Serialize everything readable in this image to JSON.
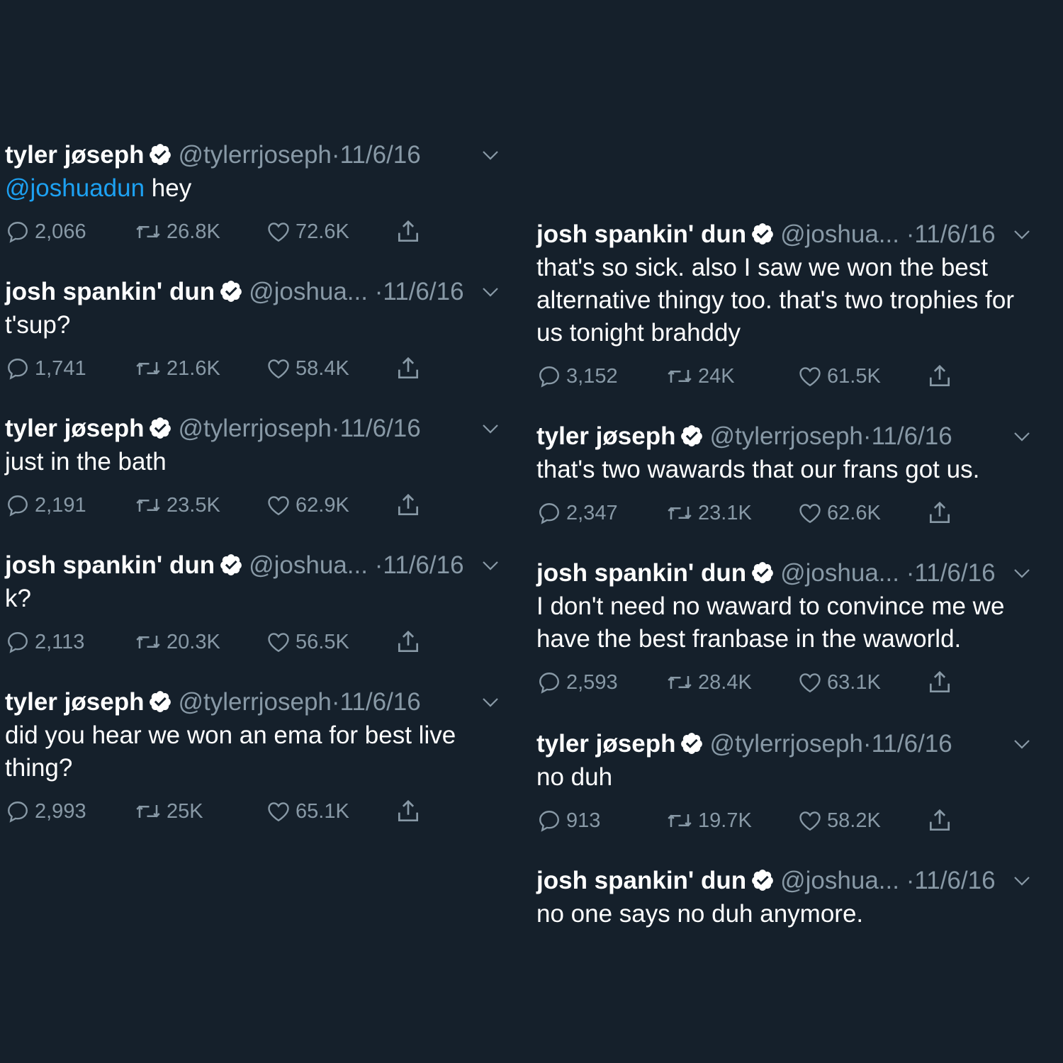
{
  "colors": {
    "background": "#15202b",
    "text": "#ffffff",
    "secondary": "#8899a6",
    "link": "#1da1f2"
  },
  "icons": [
    "verified-badge-icon",
    "chevron-down-icon",
    "reply-icon",
    "retweet-icon",
    "like-icon",
    "share-icon"
  ],
  "left_column": [
    {
      "name": "tyler jøseph",
      "handle": "@tylerrjoseph",
      "separator": "·",
      "date": "11/6/16",
      "mention": "@joshuadun",
      "text": " hey",
      "replies": "2,066",
      "retweets": "26.8K",
      "likes": "72.6K"
    },
    {
      "name": "josh spankin' dun",
      "handle": "@joshua...",
      "separator": " ·",
      "date": "11/6/16",
      "text": "t'sup?",
      "replies": "1,741",
      "retweets": "21.6K",
      "likes": "58.4K"
    },
    {
      "name": "tyler jøseph",
      "handle": "@tylerrjoseph",
      "separator": "·",
      "date": "11/6/16",
      "text": "just in the bath",
      "replies": "2,191",
      "retweets": "23.5K",
      "likes": "62.9K"
    },
    {
      "name": "josh spankin' dun",
      "handle": "@joshua...",
      "separator": " ·",
      "date": "11/6/16",
      "text": "k?",
      "replies": "2,113",
      "retweets": "20.3K",
      "likes": "56.5K"
    },
    {
      "name": "tyler jøseph",
      "handle": "@tylerrjoseph",
      "separator": "·",
      "date": "11/6/16",
      "text": "did you hear we won an ema for best live thing?",
      "replies": "2,993",
      "retweets": "25K",
      "likes": "65.1K"
    }
  ],
  "right_column": [
    {
      "name": "josh spankin' dun",
      "handle": "@joshua...",
      "separator": " ·",
      "date": "11/6/16",
      "text": "that's so sick. also I saw we won the best alternative thingy too. that's two trophies for us tonight brahddy",
      "replies": "3,152",
      "retweets": "24K",
      "likes": "61.5K"
    },
    {
      "name": "tyler jøseph",
      "handle": "@tylerrjoseph",
      "separator": "·",
      "date": "11/6/16",
      "text": "that's two wawards that our frans got us.",
      "replies": "2,347",
      "retweets": "23.1K",
      "likes": "62.6K"
    },
    {
      "name": "josh spankin' dun",
      "handle": "@joshua...",
      "separator": " ·",
      "date": "11/6/16",
      "text": "I don't need no waward to convince me we have the best franbase in the waworld.",
      "replies": "2,593",
      "retweets": "28.4K",
      "likes": "63.1K"
    },
    {
      "name": "tyler jøseph",
      "handle": "@tylerrjoseph",
      "separator": "·",
      "date": "11/6/16",
      "text": "no duh",
      "replies": "913",
      "retweets": "19.7K",
      "likes": "58.2K"
    },
    {
      "name": "josh spankin' dun",
      "handle": "@joshua...",
      "separator": " ·",
      "date": "11/6/16",
      "text": "no one says no duh anymore."
    }
  ]
}
